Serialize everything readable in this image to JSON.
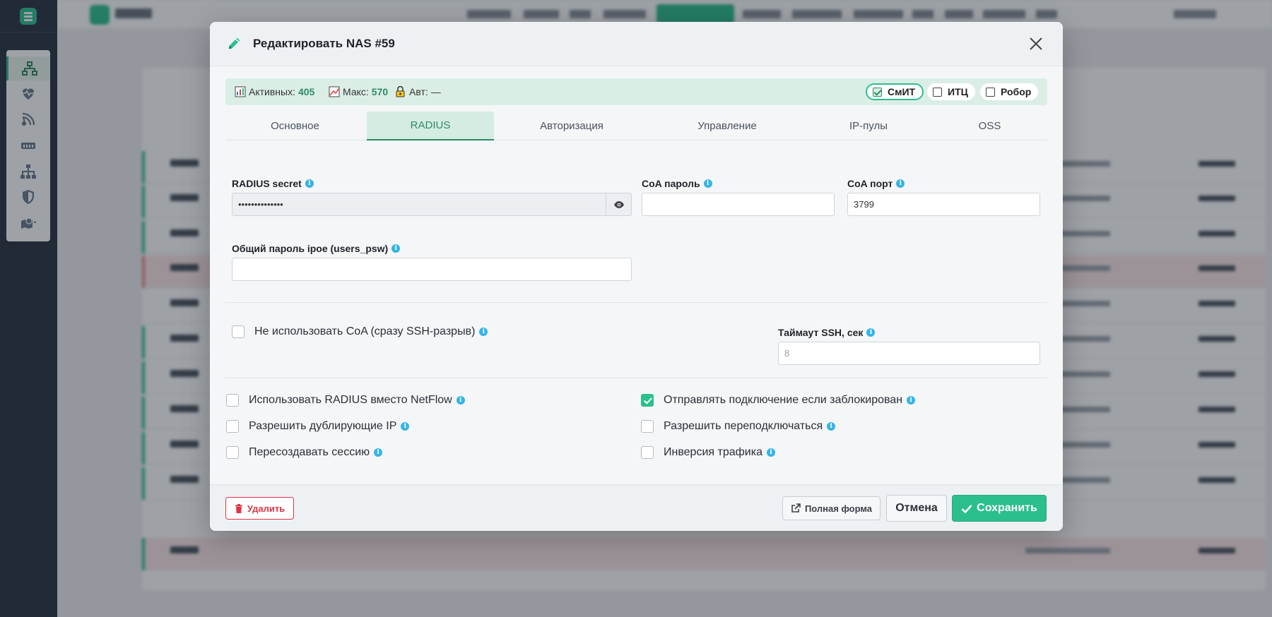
{
  "modal": {
    "title": "Редактировать NAS #59",
    "stats": {
      "active_label": "Активных:",
      "active_value": "405",
      "max_label": "Макс:",
      "max_value": "570",
      "auth_label": "Авт:",
      "auth_value": "—"
    },
    "providers": [
      {
        "label": "СмИТ",
        "checked": true
      },
      {
        "label": "ИТЦ",
        "checked": false
      },
      {
        "label": "Робор",
        "checked": false
      }
    ],
    "tabs": [
      {
        "label": "Основное",
        "active": false
      },
      {
        "label": "RADIUS",
        "active": true
      },
      {
        "label": "Авторизация",
        "active": false
      },
      {
        "label": "Управление",
        "active": false
      },
      {
        "label": "IP-пулы",
        "active": false
      },
      {
        "label": "OSS",
        "active": false
      }
    ],
    "fields": {
      "radius_secret_label": "RADIUS secret",
      "radius_secret_value": "••••••••••••••",
      "coa_password_label": "CoA пароль",
      "coa_password_value": "",
      "coa_port_label": "CoA порт",
      "coa_port_value": "3799",
      "ipoe_password_label": "Общий пароль ipoe (users_psw)",
      "ipoe_password_value": "",
      "ssh_timeout_label": "Таймаут SSH, сек",
      "ssh_timeout_placeholder": "8"
    },
    "checkboxes": {
      "no_coa": {
        "label": "Не использовать CoA (сразу SSH-разрыв)",
        "checked": false
      },
      "radius_netflow": {
        "label": "Использовать RADIUS вместо NetFlow",
        "checked": false
      },
      "dup_ip": {
        "label": "Разрешить дублирующие IP",
        "checked": false
      },
      "recreate_session": {
        "label": "Пересоздавать сессию",
        "checked": false
      },
      "send_if_blocked": {
        "label": "Отправлять подключение если заблокирован",
        "checked": true
      },
      "allow_reconnect": {
        "label": "Разрешить переподключаться",
        "checked": false
      },
      "traffic_inversion": {
        "label": "Инверсия трафика",
        "checked": false
      }
    },
    "footer": {
      "delete_label": "Удалить",
      "full_form_label": "Полная форма",
      "cancel_label": "Отмена",
      "save_label": "Сохранить"
    }
  },
  "colors": {
    "accent": "#2bbf8e",
    "accent_dark": "#2e8b63",
    "danger": "#dc3545",
    "info": "#35b4e6",
    "sidebar": "#2a3343"
  },
  "sidebar_icons": [
    "network-icon",
    "heartbeat-icon",
    "satellite-icon",
    "router-icon",
    "sitemap-icon",
    "shield-icon",
    "map-pin-icon"
  ]
}
